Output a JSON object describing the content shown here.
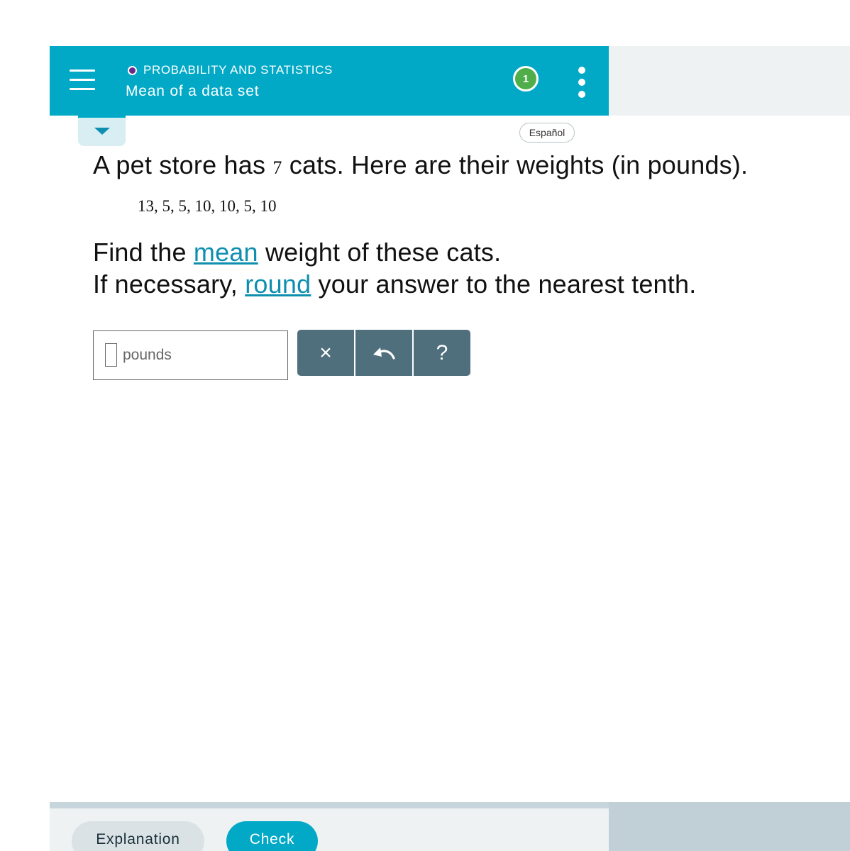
{
  "header": {
    "topic": "PROBABILITY AND STATISTICS",
    "title": "Mean of a data set",
    "progress": "1"
  },
  "language_button": "Español",
  "question": {
    "text_before": "A pet store has ",
    "count": "7",
    "text_after": " cats. Here are their weights (in pounds).",
    "dataset": "13, 5, 5, 10, 10, 5, 10",
    "line1_before": "Find the ",
    "line1_link": "mean",
    "line1_after": " weight of these cats.",
    "line2_before": "If necessary, ",
    "line2_link": "round",
    "line2_after": " your answer to the nearest tenth."
  },
  "answer": {
    "unit": "pounds",
    "value": ""
  },
  "toolbar": {
    "clear_symbol": "×",
    "undo_symbol": "↶",
    "help_symbol": "?"
  },
  "footer": {
    "explanation_label": "Explanation",
    "check_label": "Check"
  },
  "colors": {
    "brand_teal": "#01a9c7",
    "progress_green": "#50ae4a",
    "topic_purple": "#6a2a8c",
    "toolbar_slate": "#4f6f7d",
    "link_blue": "#0f8fb0"
  }
}
